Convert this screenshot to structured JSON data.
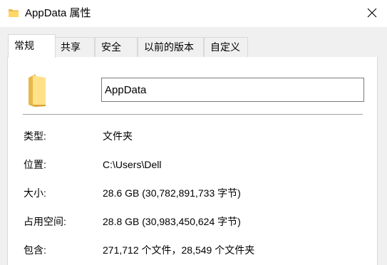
{
  "window": {
    "title": "AppData 属性",
    "title_icon": "folder-icon",
    "close_icon": "close-icon"
  },
  "tabs": [
    {
      "label": "常规",
      "active": true
    },
    {
      "label": "共享",
      "active": false
    },
    {
      "label": "安全",
      "active": false
    },
    {
      "label": "以前的版本",
      "active": false
    },
    {
      "label": "自定义",
      "active": false
    }
  ],
  "general": {
    "folder_icon": "folder-icon",
    "name_value": "AppData",
    "properties": [
      {
        "label": "类型:",
        "value": "文件夹"
      },
      {
        "label": "位置:",
        "value": "C:\\Users\\Dell"
      },
      {
        "label": "大小:",
        "value": "28.6 GB (30,782,891,733 字节)"
      },
      {
        "label": "占用空间:",
        "value": "28.8 GB (30,983,450,624 字节)"
      },
      {
        "label": "包含:",
        "value": "271,712 个文件，28,549 个文件夹"
      }
    ]
  },
  "colors": {
    "folder_light": "#ffe18a",
    "folder_dark": "#e8b84a",
    "panel_bg": "#f0f0f0"
  }
}
